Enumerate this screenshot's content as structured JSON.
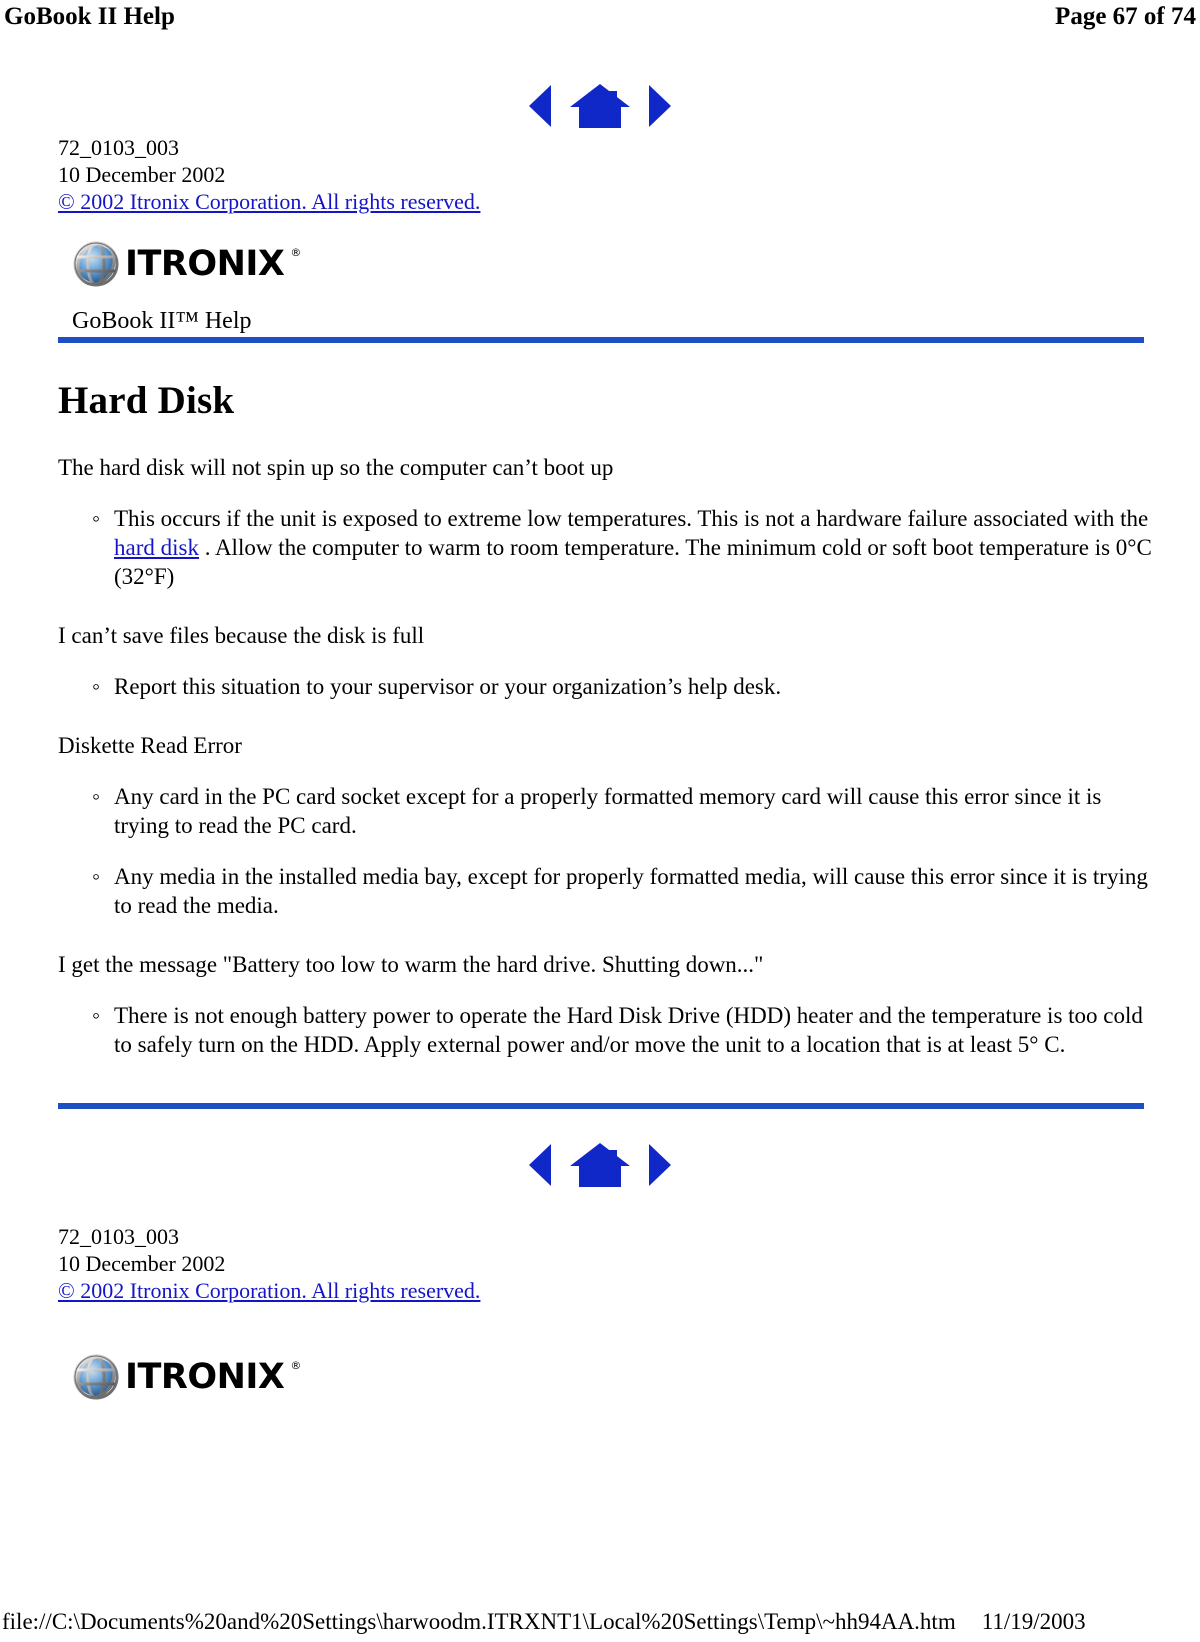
{
  "page_header": {
    "left_title": "GoBook II Help",
    "right_page": "Page 67 of 74"
  },
  "nav": {
    "prev_icon": "triangle-left-icon",
    "home_icon": "home-icon",
    "next_icon": "triangle-right-icon"
  },
  "doc_meta": {
    "doc_number": "72_0103_003",
    "date": "10 December 2002",
    "copyright_link": "© 2002 Itronix Corporation.  All rights reserved."
  },
  "logo": {
    "globe_icon": "globe-icon",
    "wordmark": "ITRONIX",
    "registered": "®"
  },
  "banner": {
    "title": "GoBook II™ Help"
  },
  "article": {
    "title": "Hard Disk",
    "sections": [
      {
        "heading": "The hard disk will not spin up so the computer can’t boot up",
        "bullets": [
          {
            "before": "This occurs if the unit is exposed to extreme low temperatures. This is not a hardware failure associated with the ",
            "link": "hard disk",
            "after": " .  Allow the computer to warm to room temperature.  The minimum cold or soft boot temperature is 0°C (32°F)"
          }
        ]
      },
      {
        "heading": "I can’t save files because the disk is full",
        "bullets": [
          {
            "before": "Report this situation to your supervisor or your organization’s help desk.",
            "link": "",
            "after": ""
          }
        ]
      },
      {
        "heading": "Diskette Read Error",
        "bullets": [
          {
            "before": "Any card in the PC card socket except for a properly formatted memory card will cause this error since it is trying to read the PC card.",
            "link": "",
            "after": ""
          },
          {
            "before": "Any media in the installed media bay, except for properly formatted media, will cause this error since it is trying to read the media.",
            "link": "",
            "after": ""
          }
        ]
      },
      {
        "heading": "I get the message \"Battery too low to warm the hard drive.  Shutting down...\"",
        "bullets": [
          {
            "before": "There is not enough battery power to operate the Hard Disk Drive (HDD) heater and the temperature is too cold to safely turn on the HDD.  Apply external power and/or move the unit to a location that is at least 5° C.",
            "link": "",
            "after": ""
          }
        ]
      }
    ]
  },
  "footer_meta": {
    "doc_number": "72_0103_003",
    "date": "10 December 2002",
    "copyright_link": "© 2002 Itronix Corporation.  All rights reserved."
  },
  "page_footer": {
    "file_path": "file://C:\\Documents%20and%20Settings\\harwoodm.ITRXNT1\\Local%20Settings\\Temp\\~hh94AA.htm",
    "date": "11/19/2003"
  },
  "colors": {
    "link_blue": "#1414c8",
    "rule_blue": "#1f4fc4",
    "icon_blue": "#1128c8"
  }
}
